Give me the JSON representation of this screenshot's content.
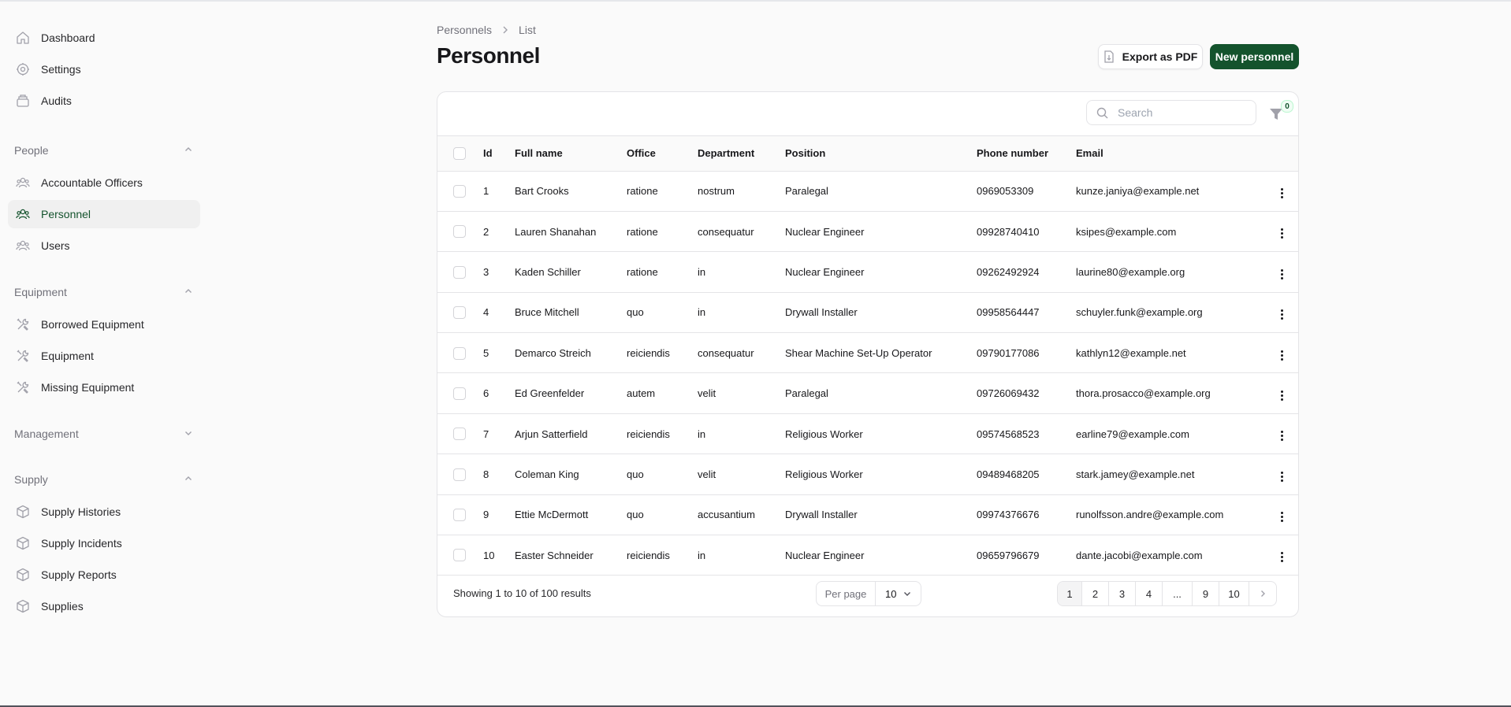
{
  "sidebar": {
    "top_items": [
      {
        "label": "Dashboard",
        "icon": "home-icon"
      },
      {
        "label": "Settings",
        "icon": "settings-icon"
      },
      {
        "label": "Audits",
        "icon": "archive-icon"
      }
    ],
    "groups": [
      {
        "label": "People",
        "expanded": true,
        "items": [
          {
            "label": "Accountable Officers",
            "icon": "users-icon"
          },
          {
            "label": "Personnel",
            "icon": "users-icon",
            "active": true
          },
          {
            "label": "Users",
            "icon": "users-icon"
          }
        ]
      },
      {
        "label": "Equipment",
        "expanded": true,
        "items": [
          {
            "label": "Borrowed Equipment",
            "icon": "tools-icon"
          },
          {
            "label": "Equipment",
            "icon": "tools-icon"
          },
          {
            "label": "Missing Equipment",
            "icon": "tools-icon"
          }
        ]
      },
      {
        "label": "Management",
        "expanded": false,
        "items": []
      },
      {
        "label": "Supply",
        "expanded": true,
        "items": [
          {
            "label": "Supply Histories",
            "icon": "cube-icon"
          },
          {
            "label": "Supply Incidents",
            "icon": "cube-icon"
          },
          {
            "label": "Supply Reports",
            "icon": "cube-icon"
          },
          {
            "label": "Supplies",
            "icon": "cube-icon"
          }
        ]
      }
    ]
  },
  "breadcrumb": {
    "parent": "Personnels",
    "separator": "›",
    "current": "List"
  },
  "page": {
    "title": "Personnel"
  },
  "actions": {
    "export_label": "Export as PDF",
    "new_label": "New personnel"
  },
  "colors": {
    "primary": "#14532d",
    "border": "#e4e4e7",
    "muted": "#71717a"
  },
  "toolbar": {
    "search_placeholder": "Search",
    "filter_count": "0"
  },
  "table": {
    "columns": [
      "Id",
      "Full name",
      "Office",
      "Department",
      "Position",
      "Phone number",
      "Email"
    ],
    "rows": [
      [
        "1",
        "Bart Crooks",
        "ratione",
        "nostrum",
        "Paralegal",
        "0969053309",
        "kunze.janiya@example.net"
      ],
      [
        "2",
        "Lauren Shanahan",
        "ratione",
        "consequatur",
        "Nuclear Engineer",
        "09928740410",
        "ksipes@example.com"
      ],
      [
        "3",
        "Kaden Schiller",
        "ratione",
        "in",
        "Nuclear Engineer",
        "09262492924",
        "laurine80@example.org"
      ],
      [
        "4",
        "Bruce Mitchell",
        "quo",
        "in",
        "Drywall Installer",
        "09958564447",
        "schuyler.funk@example.org"
      ],
      [
        "5",
        "Demarco Streich",
        "reiciendis",
        "consequatur",
        "Shear Machine Set-Up Operator",
        "09790177086",
        "kathlyn12@example.net"
      ],
      [
        "6",
        "Ed Greenfelder",
        "autem",
        "velit",
        "Paralegal",
        "09726069432",
        "thora.prosacco@example.org"
      ],
      [
        "7",
        "Arjun Satterfield",
        "reiciendis",
        "in",
        "Religious Worker",
        "09574568523",
        "earline79@example.com"
      ],
      [
        "8",
        "Coleman King",
        "quo",
        "velit",
        "Religious Worker",
        "09489468205",
        "stark.jamey@example.net"
      ],
      [
        "9",
        "Ettie McDermott",
        "quo",
        "accusantium",
        "Drywall Installer",
        "09974376676",
        "runolfsson.andre@example.com"
      ],
      [
        "10",
        "Easter Schneider",
        "reiciendis",
        "in",
        "Nuclear Engineer",
        "09659796679",
        "dante.jacobi@example.com"
      ]
    ]
  },
  "footer": {
    "results_text": "Showing 1 to 10 of 100 results",
    "per_page_label": "Per page",
    "per_page_value": "10",
    "pages": [
      "1",
      "2",
      "3",
      "4",
      "...",
      "9",
      "10"
    ],
    "current_page": "1",
    "next_symbol": "›"
  }
}
